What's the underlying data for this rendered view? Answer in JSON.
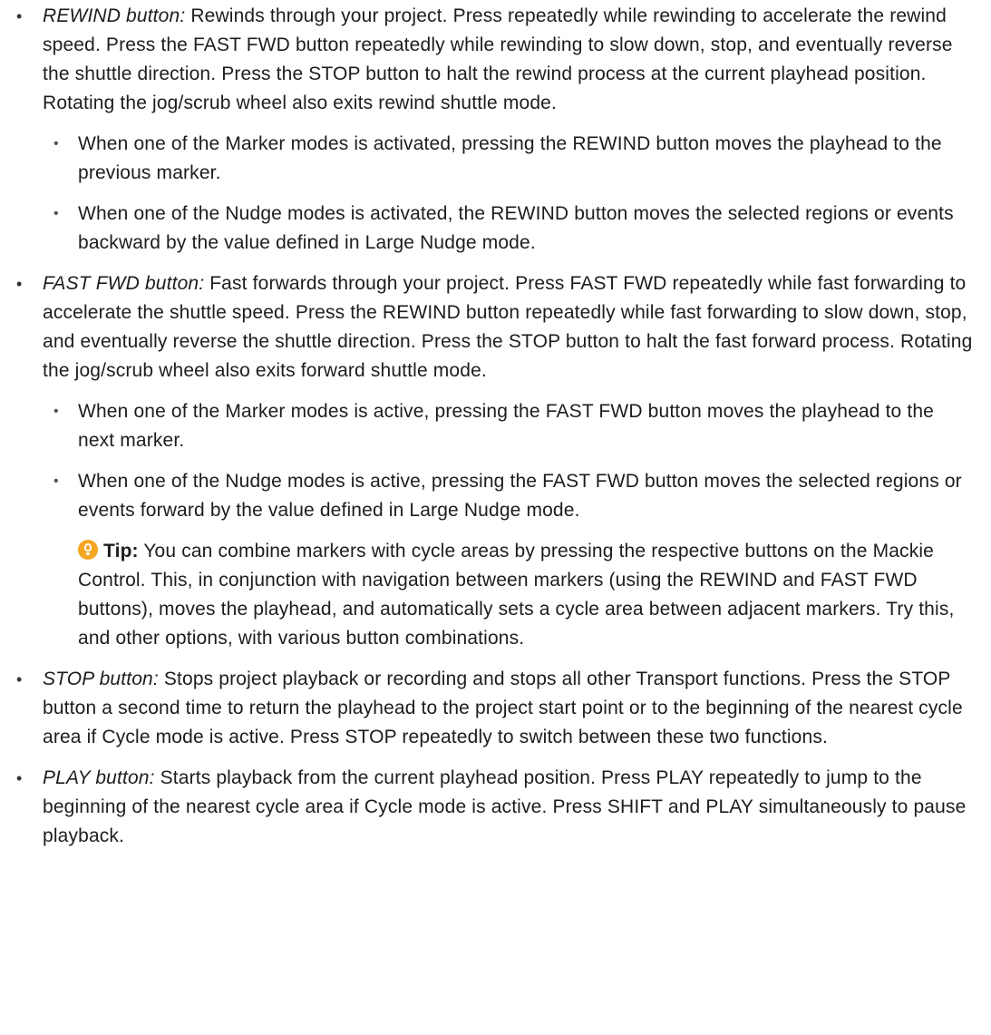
{
  "items": [
    {
      "term": "REWIND button:",
      "text": " Rewinds through your project. Press repeatedly while rewinding to accelerate the rewind speed. Press the FAST FWD button repeatedly while rewinding to slow down, stop, and eventually reverse the shuttle direction. Press the STOP button to halt the rewind process at the current playhead position. Rotating the jog/scrub wheel also exits rewind shuttle mode.",
      "subitems": [
        "When one of the Marker modes is activated, pressing the REWIND button moves the playhead to the previous marker.",
        "When one of the Nudge modes is activated, the REWIND button moves the selected regions or events backward by the value defined in Large Nudge mode."
      ]
    },
    {
      "term": "FAST FWD button:",
      "text": " Fast forwards through your project. Press FAST FWD repeatedly while fast forwarding to accelerate the shuttle speed. Press the REWIND button repeatedly while fast forwarding to slow down, stop, and eventually reverse the shuttle direction. Press the STOP button to halt the fast forward process. Rotating the jog/scrub wheel also exits forward shuttle mode.",
      "subitems": [
        "When one of the Marker modes is active, pressing the FAST FWD button moves the playhead to the next marker.",
        "When one of the Nudge modes is active, pressing the FAST FWD button moves the selected regions or events forward by the value defined in Large Nudge mode."
      ],
      "tip": {
        "label": "Tip:",
        "text": " You can combine markers with cycle areas by pressing the respective buttons on the Mackie Control. This, in conjunction with navigation between markers (using the REWIND and FAST FWD buttons), moves the playhead, and automatically sets a cycle area between adjacent markers. Try this, and other options, with various button combinations.",
        "icon": "lightbulb-icon",
        "icon_color": "#f5a623"
      }
    },
    {
      "term": "STOP button:",
      "text": " Stops project playback or recording and stops all other Transport functions. Press the STOP button a second time to return the playhead to the project start point or to the beginning of the nearest cycle area if Cycle mode is active. Press STOP repeatedly to switch between these two functions."
    },
    {
      "term": "PLAY button:",
      "text": " Starts playback from the current playhead position. Press PLAY repeatedly to jump to the beginning of the nearest cycle area if Cycle mode is active. Press SHIFT and PLAY simultaneously to pause playback."
    }
  ],
  "bullet_glyph": "•"
}
